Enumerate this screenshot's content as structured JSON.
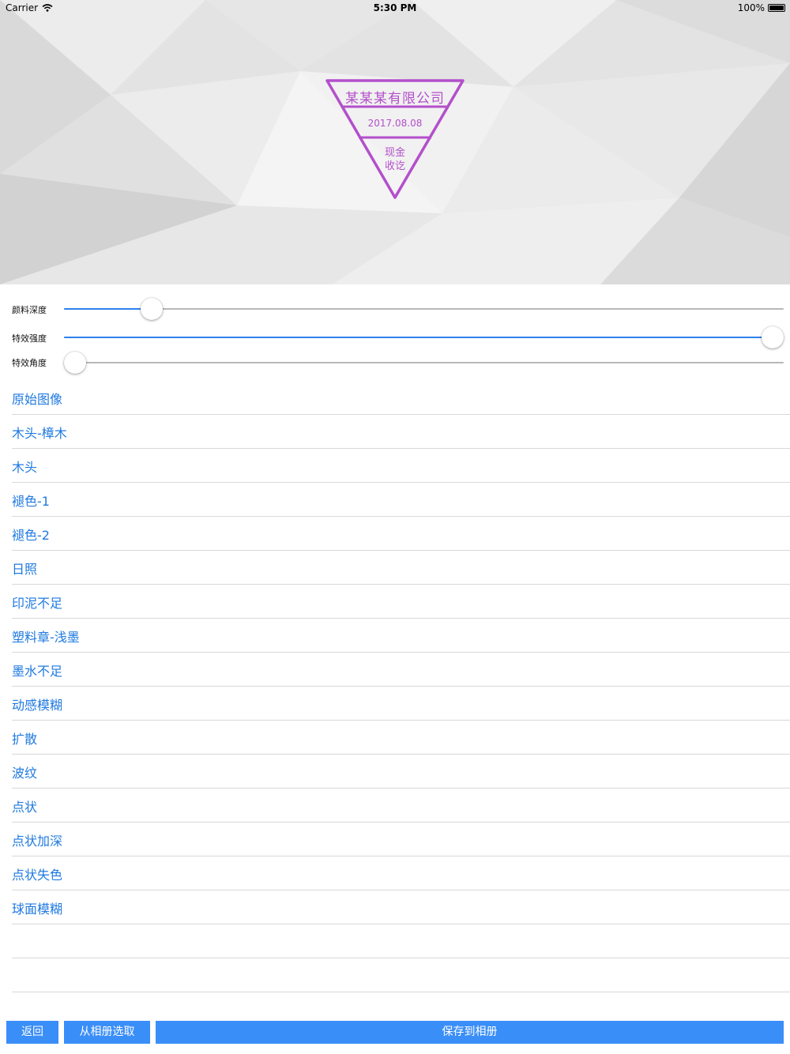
{
  "status_bar": {
    "carrier": "Carrier",
    "time": "5:30 PM",
    "battery": "100%"
  },
  "stamp": {
    "company": "某某某有限公司",
    "date": "2017.08.08",
    "text_line1": "现金",
    "text_line2": "收讫",
    "color": "#b34fcb"
  },
  "sliders": [
    {
      "label": "颜料深度",
      "value": 0.11
    },
    {
      "label": "特效强度",
      "value": 1.0
    },
    {
      "label": "特效角度",
      "value": 0.0
    }
  ],
  "effects": [
    "原始图像",
    "木头-樟木",
    "木头",
    "褪色-1",
    "褪色-2",
    "日照",
    "印泥不足",
    "塑料章-浅墨",
    "墨水不足",
    "动感模糊",
    "扩散",
    "波纹",
    "点状",
    "点状加深",
    "点状失色",
    "球面模糊",
    "",
    ""
  ],
  "buttons": {
    "back": "返回",
    "pick_from_album": "从相册选取",
    "save_to_album": "保存到相册"
  },
  "colors": {
    "accent": "#3a8ef8",
    "link": "#1f7ae0",
    "track_active": "#2f80ed",
    "track_inactive": "#b8b8b8"
  }
}
